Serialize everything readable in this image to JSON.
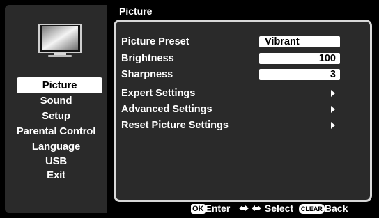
{
  "title": "Picture",
  "sidebar": {
    "items": [
      {
        "label": "Picture",
        "active": true
      },
      {
        "label": "Sound"
      },
      {
        "label": "Setup"
      },
      {
        "label": "Parental Control"
      },
      {
        "label": "Language"
      },
      {
        "label": "USB"
      },
      {
        "label": "Exit"
      }
    ]
  },
  "settings": {
    "picture_preset": {
      "label": "Picture Preset",
      "value": "Vibrant"
    },
    "brightness": {
      "label": "Brightness",
      "value": "100"
    },
    "sharpness": {
      "label": "Sharpness",
      "value": "3"
    },
    "expert": {
      "label": "Expert Settings"
    },
    "advanced": {
      "label": "Advanced Settings"
    },
    "reset": {
      "label": "Reset Picture Settings"
    }
  },
  "footer": {
    "ok_badge": "OK",
    "enter": "Enter",
    "select": "Select",
    "clear_badge": "CLEAR",
    "back": "Back"
  },
  "colors": {
    "background": "#000000",
    "panel": "#2a2a2a",
    "highlight": "#ffffff"
  },
  "icons": [
    "tv-icon",
    "chevron-right-icon",
    "up-down-arrows-icon"
  ]
}
